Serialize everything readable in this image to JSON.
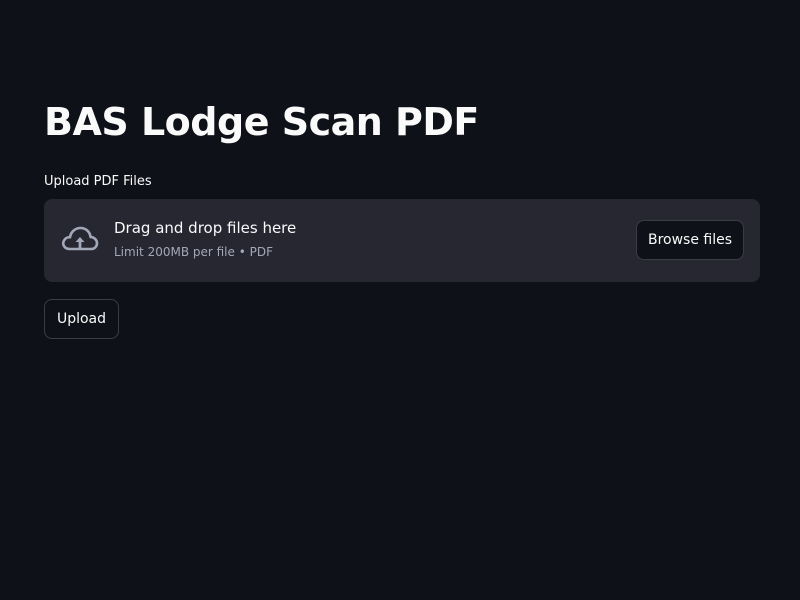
{
  "page": {
    "title": "BAS Lodge Scan PDF"
  },
  "uploader": {
    "label": "Upload PDF Files",
    "dropzone_title": "Drag and drop files here",
    "dropzone_subtitle": "Limit 200MB per file • PDF",
    "browse_label": "Browse files",
    "icon": "cloud-upload-icon"
  },
  "actions": {
    "upload_label": "Upload"
  },
  "colors": {
    "background": "#0e1117",
    "dropzone": "#262730",
    "text": "#fafafa",
    "muted_text": "#a3a8b8",
    "border": "#3a3d47"
  }
}
